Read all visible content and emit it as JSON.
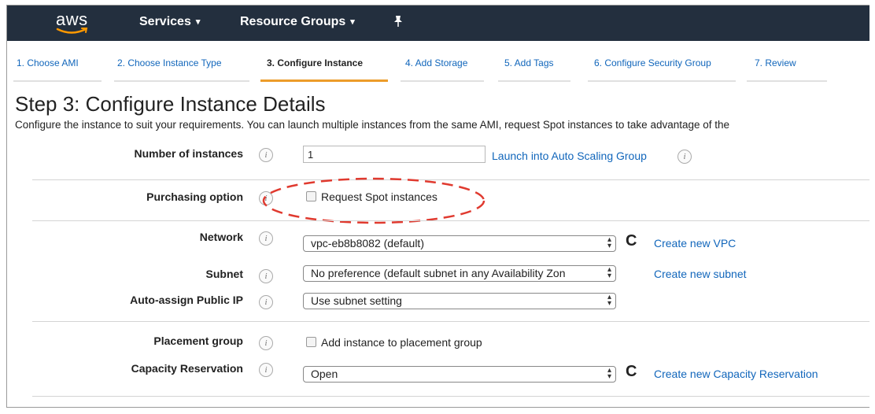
{
  "topbar": {
    "logo_text": "aws",
    "services": "Services",
    "resource_groups": "Resource Groups",
    "pin_icon": "pin-icon"
  },
  "steps": [
    {
      "label": "1. Choose AMI",
      "active": false
    },
    {
      "label": "2. Choose Instance Type",
      "active": false
    },
    {
      "label": "3. Configure Instance",
      "active": true
    },
    {
      "label": "4. Add Storage",
      "active": false
    },
    {
      "label": "5. Add Tags",
      "active": false
    },
    {
      "label": "6. Configure Security Group",
      "active": false
    },
    {
      "label": "7. Review",
      "active": false
    }
  ],
  "page": {
    "title": "Step 3: Configure Instance Details",
    "description": "Configure the instance to suit your requirements. You can launch multiple instances from the same AMI, request Spot instances to take advantage of the"
  },
  "form": {
    "num_instances": {
      "label": "Number of instances",
      "value": "1",
      "link": "Launch into Auto Scaling Group"
    },
    "purchasing": {
      "label": "Purchasing option",
      "checkbox": "Request Spot instances"
    },
    "network": {
      "label": "Network",
      "value": "vpc-eb8b8082 (default)",
      "link": "Create new VPC"
    },
    "subnet": {
      "label": "Subnet",
      "value": "No preference (default subnet in any Availability Zon",
      "link": "Create new subnet"
    },
    "public_ip": {
      "label": "Auto-assign Public IP",
      "value": "Use subnet setting"
    },
    "placement": {
      "label": "Placement group",
      "checkbox": "Add instance to placement group"
    },
    "capacity": {
      "label": "Capacity Reservation",
      "value": "Open",
      "link": "Create new Capacity Reservation"
    }
  },
  "icons": {
    "info": "i",
    "refresh": "C",
    "select_arrows": "▴▾"
  },
  "colors": {
    "topbar": "#232f3e",
    "link": "#1166bb",
    "active_step": "#ec9c2a",
    "annotation": "#e03a2f"
  }
}
